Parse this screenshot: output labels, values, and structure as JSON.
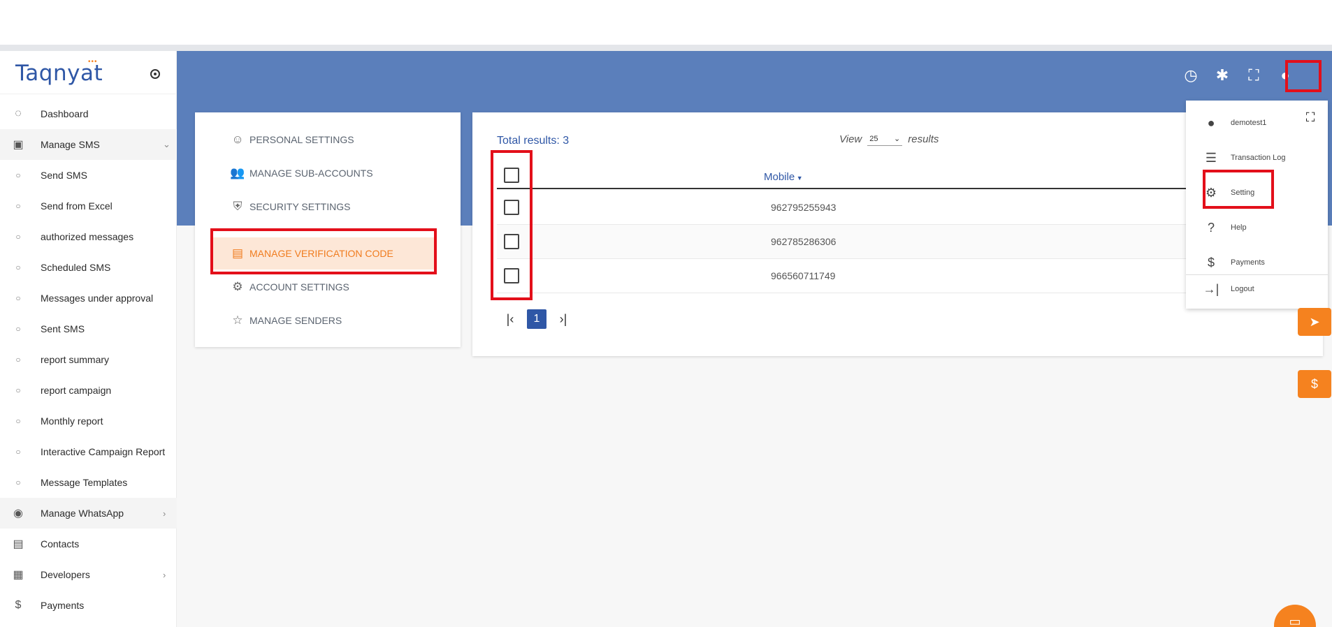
{
  "brand": {
    "name": "Taqnyat",
    "dots": "•••"
  },
  "sidebar": {
    "items": [
      {
        "label": "Dashboard",
        "icon": "dashboard-icon"
      },
      {
        "label": "Manage SMS",
        "icon": "sms-icon"
      },
      {
        "label": "Send SMS"
      },
      {
        "label": "Send from Excel"
      },
      {
        "label": "authorized messages"
      },
      {
        "label": "Scheduled SMS"
      },
      {
        "label": "Messages under approval"
      },
      {
        "label": "Sent SMS"
      },
      {
        "label": "report summary"
      },
      {
        "label": "report campaign"
      },
      {
        "label": "Monthly report"
      },
      {
        "label": "Interactive Campaign Report"
      },
      {
        "label": "Message Templates"
      },
      {
        "label": "Manage WhatsApp",
        "icon": "whatsapp-icon"
      },
      {
        "label": "Contacts",
        "icon": "contacts-icon"
      },
      {
        "label": "Developers",
        "icon": "developers-icon"
      },
      {
        "label": "Payments",
        "icon": "dollar-icon"
      }
    ]
  },
  "settings_menu": {
    "items": [
      {
        "label": "PERSONAL SETTINGS"
      },
      {
        "label": "MANAGE SUB-ACCOUNTS"
      },
      {
        "label": "SECURITY SETTINGS"
      },
      {
        "label": "MANAGE VERIFICATION CODE"
      },
      {
        "label": "ACCOUNT SETTINGS"
      },
      {
        "label": "MANAGE SENDERS"
      }
    ],
    "active_index": 3
  },
  "results": {
    "total": "Total results: 3",
    "view_label": "View",
    "page_size": "25",
    "results_label": "results",
    "column_mobile": "Mobile",
    "rows": [
      "962795255943",
      "962785286306",
      "966560711749"
    ],
    "current_page": "1"
  },
  "profile_menu": {
    "username": "demotest1",
    "items": [
      {
        "label": "Transaction Log"
      },
      {
        "label": "Setting"
      },
      {
        "label": "Help"
      },
      {
        "label": "Payments"
      },
      {
        "label": "Logout"
      }
    ]
  },
  "colors": {
    "header_blue": "#5b7fbb",
    "accent_orange": "#f07c1f",
    "highlight_red": "#e30f1a",
    "link_blue": "#2f57a6"
  }
}
